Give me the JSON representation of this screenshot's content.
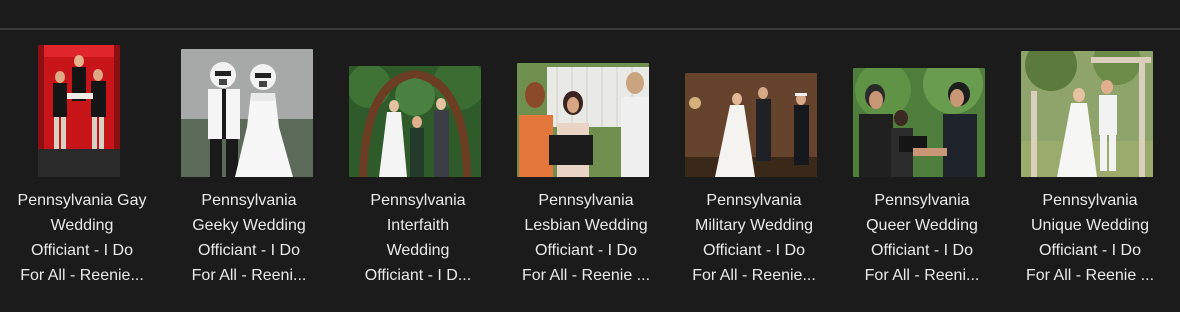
{
  "files": [
    {
      "name_lines": [
        "Pennsylvania Gay",
        "Wedding",
        "Officiant - I Do",
        "For All - Reenie..."
      ],
      "thumb_icon": "gay-wedding-thumbnail"
    },
    {
      "name_lines": [
        "Pennsylvania",
        "Geeky Wedding",
        "Officiant - I Do",
        "For All - Reeni..."
      ],
      "thumb_icon": "geeky-wedding-thumbnail"
    },
    {
      "name_lines": [
        "Pennsylvania",
        "Interfaith",
        "Wedding",
        "Officiant - I D..."
      ],
      "thumb_icon": "interfaith-wedding-thumbnail"
    },
    {
      "name_lines": [
        "Pennsylvania",
        "Lesbian Wedding",
        "Officiant - I Do",
        "For All - Reenie ..."
      ],
      "thumb_icon": "lesbian-wedding-thumbnail"
    },
    {
      "name_lines": [
        "Pennsylvania",
        "Military Wedding",
        "Officiant - I Do",
        "For All - Reenie..."
      ],
      "thumb_icon": "military-wedding-thumbnail"
    },
    {
      "name_lines": [
        "Pennsylvania",
        "Queer Wedding",
        "Officiant - I Do",
        "For All - Reeni..."
      ],
      "thumb_icon": "queer-wedding-thumbnail"
    },
    {
      "name_lines": [
        "Pennsylvania",
        "Unique Wedding",
        "Officiant - I Do",
        "For All - Reenie ..."
      ],
      "thumb_icon": "unique-wedding-thumbnail"
    }
  ]
}
